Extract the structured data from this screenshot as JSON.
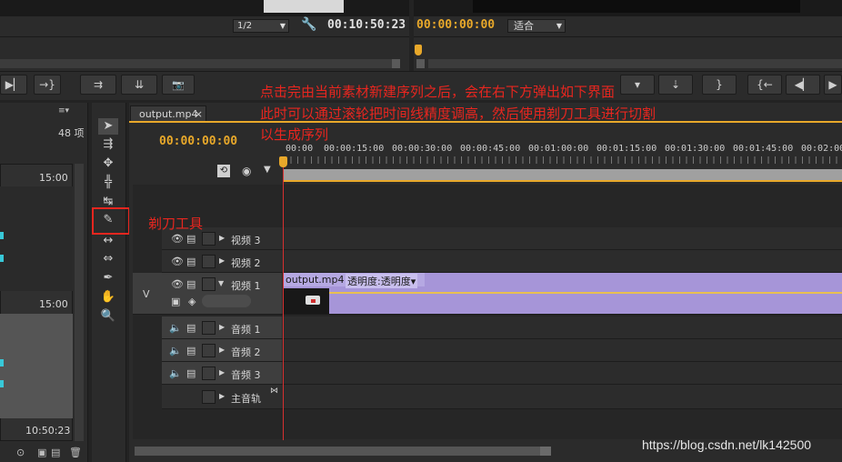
{
  "monitor": {
    "resolution": "1/2",
    "source_timecode": "00:10:50:23",
    "program_timecode": "00:00:00:00",
    "fit": "适合"
  },
  "transport": [
    "▶▏",
    "→}",
    "⇉",
    "⇊",
    "📷"
  ],
  "transport_right": [
    "▾",
    "⇣",
    "}",
    "{←",
    "◀▏",
    "▶"
  ],
  "project_panel": {
    "count": "48 项",
    "times": [
      "15:00",
      "15:00",
      "10:50:23"
    ]
  },
  "sequence": {
    "tab": "output.mp4",
    "close": "×",
    "timecode": "00:00:00:00",
    "ruler": [
      "00:00",
      "00:00:15:00",
      "00:00:30:00",
      "00:00:45:00",
      "00:01:00:00",
      "00:01:15:00",
      "00:01:30:00",
      "00:01:45:00",
      "00:02:00"
    ],
    "tracks": {
      "v3": "视频 3",
      "v2": "视频 2",
      "v1": "视频 1",
      "a1": "音频 1",
      "a2": "音频 2",
      "a3": "音频 3",
      "master": "主音轨"
    },
    "v_target": "V",
    "clip": {
      "name": "output.mp4",
      "effect": "透明度:透明度▾"
    }
  },
  "annotations": {
    "line1": "点击完由当前素材新建序列之后，会在右下方弹出如下界面",
    "line2": "此时可以通过滚轮把时间线精度调高，然后使用剃刀工具进行切割",
    "line3": "以生成序列",
    "razor": "剃刀工具"
  },
  "watermark": "https://blog.csdn.net/lk142500",
  "colors": {
    "accent": "#e8a82a",
    "clip": "#a695d8",
    "annotation": "#e8261f",
    "playhead": "#d63030"
  }
}
